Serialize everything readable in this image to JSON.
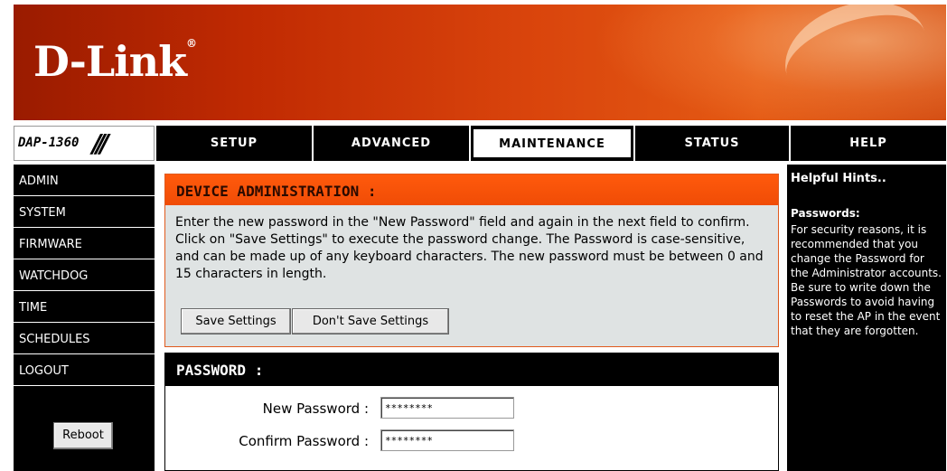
{
  "brand": {
    "logo": "D-Link",
    "model": "DAP-1360"
  },
  "nav": {
    "tabs": [
      {
        "label": "SETUP"
      },
      {
        "label": "ADVANCED"
      },
      {
        "label": "MAINTENANCE"
      },
      {
        "label": "STATUS"
      },
      {
        "label": "HELP"
      }
    ],
    "active": "MAINTENANCE"
  },
  "sidebar": {
    "items": [
      {
        "label": "ADMIN"
      },
      {
        "label": "SYSTEM"
      },
      {
        "label": "FIRMWARE"
      },
      {
        "label": "WATCHDOG"
      },
      {
        "label": "TIME"
      },
      {
        "label": "SCHEDULES"
      },
      {
        "label": "LOGOUT"
      }
    ],
    "reboot_label": "Reboot"
  },
  "admin": {
    "title": "DEVICE ADMINISTRATION :",
    "description": "Enter the new password in the \"New Password\" field and again in the next field to confirm. Click on \"Save Settings\" to execute the password change. The Password is case-sensitive, and can be made up of any keyboard characters. The new password must be between 0 and 15 characters in length.",
    "save_label": "Save Settings",
    "dont_save_label": "Don't Save Settings"
  },
  "password": {
    "title": "PASSWORD :",
    "new_label": "New Password :",
    "new_value": "********",
    "confirm_label": "Confirm Password :",
    "confirm_value": "********"
  },
  "help": {
    "title": "Helpful Hints..",
    "subtitle": "Passwords:",
    "text": "For security reasons, it is recommended that you change the Password for the Administrator accounts. Be sure to write down the Passwords to avoid having to reset the AP in the event that they are forgotten."
  },
  "colors": {
    "accent": "#ff5a0c",
    "banner": "#d9440c",
    "nav_bg": "#000000",
    "panel_bg": "#dfe3e3"
  }
}
